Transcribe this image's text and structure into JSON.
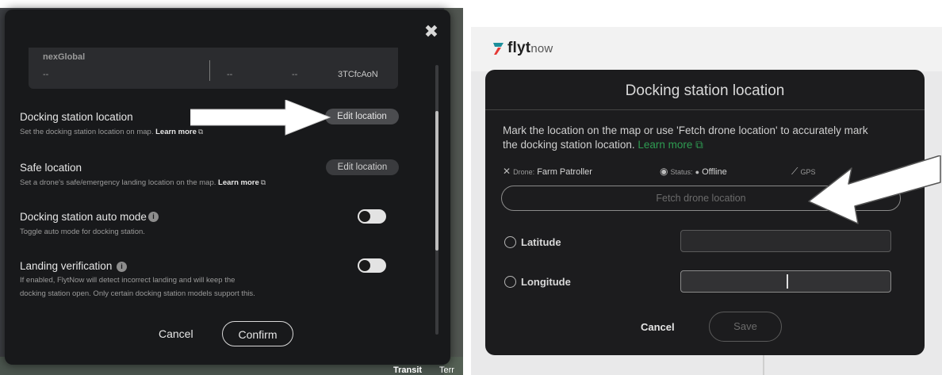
{
  "left_panel": {
    "info_card": {
      "name": "nexGlobal",
      "value1": "--",
      "value2": "--",
      "value3": "--",
      "code": "3TCfcAoN"
    },
    "docking_location": {
      "title": "Docking station location",
      "subtitle": "Set the docking station location on map.",
      "learn_more": "Learn more",
      "button": "Edit location"
    },
    "safe_location": {
      "title": "Safe location",
      "subtitle": "Set a drone's safe/emergency landing location on the map.",
      "learn_more": "Learn more",
      "button": "Edit location"
    },
    "auto_mode": {
      "title": "Docking station auto mode",
      "subtitle": "Toggle auto mode for docking station.",
      "info": "i"
    },
    "landing_verification": {
      "title": "Landing verification",
      "subtitle_line1": "If enabled, FlytNow will detect incorrect landing and will keep the",
      "subtitle_line2": "docking station open. Only certain docking station models support this.",
      "info": "i"
    },
    "close": "✖",
    "cancel": "Cancel",
    "confirm": "Confirm",
    "map_controls": {
      "transit": "Transit",
      "terrain": "Terr"
    }
  },
  "right_panel": {
    "logo": {
      "brand": "flyt",
      "suffix": "now"
    },
    "title": "Docking station location",
    "description": "Mark the location on the map or use 'Fetch drone location' to accurately mark the docking station location.",
    "learn_more": "Learn more",
    "drone_label": "Drone:",
    "drone_value": "Farm Patroller",
    "status_label": "Status:",
    "status_value": "Offline",
    "gps_label": "GPS",
    "fetch_button": "Fetch drone location",
    "latitude_label": "Latitude",
    "longitude_label": "Longitude",
    "latitude_value": "",
    "longitude_value": "",
    "cancel": "Cancel",
    "save": "Save"
  },
  "colors": {
    "modal_bg": "#18191b",
    "accent_green": "#2e9c52",
    "logo_teal": "#1e8f9b",
    "logo_red": "#e53935",
    "arrow_fill": "#ffffff"
  }
}
